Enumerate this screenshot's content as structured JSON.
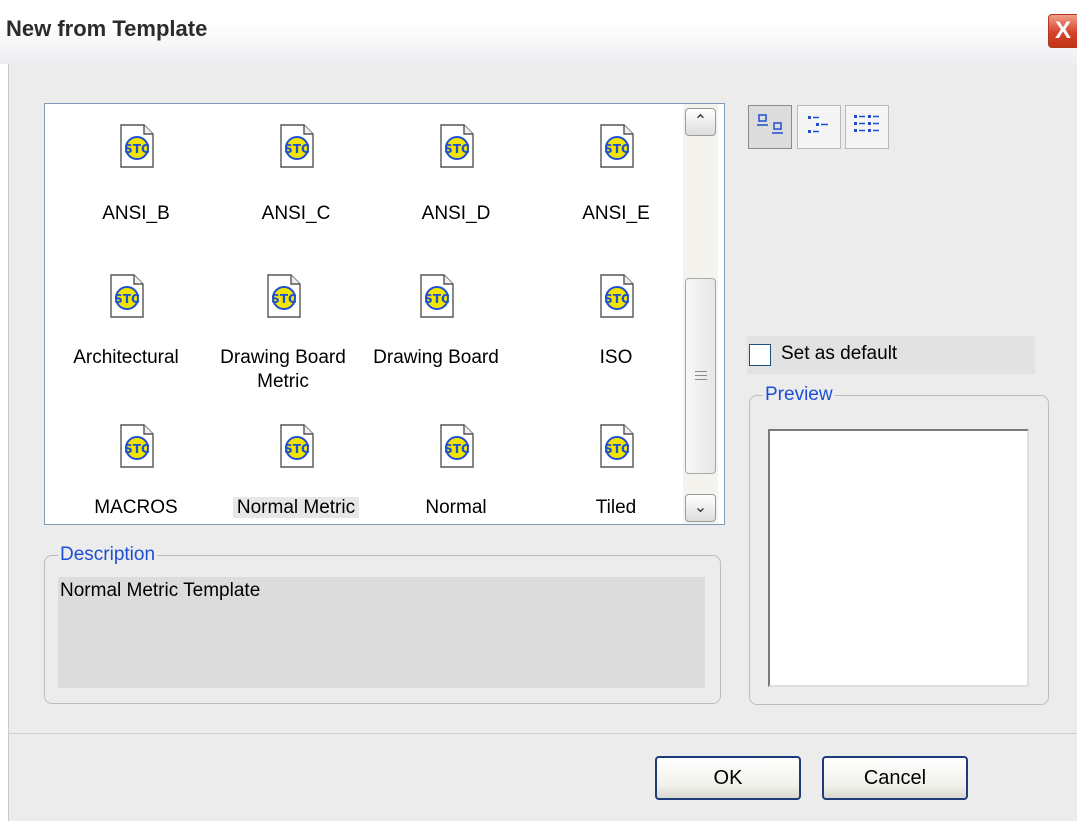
{
  "window": {
    "title": "New from Template",
    "close_glyph": "X"
  },
  "templates": [
    {
      "label": "ANSI_B",
      "icon": "stc-template-icon"
    },
    {
      "label": "ANSI_C",
      "icon": "stc-template-icon"
    },
    {
      "label": "ANSI_D",
      "icon": "stc-template-icon"
    },
    {
      "label": "ANSI_E",
      "icon": "stc-template-icon"
    },
    {
      "label": "Architectural",
      "icon": "stc-template-icon"
    },
    {
      "label_line1": "Drawing Board",
      "label_line2": "Metric",
      "icon": "stc-template-icon"
    },
    {
      "label": "Drawing Board",
      "icon": "stc-template-icon"
    },
    {
      "label": "ISO",
      "icon": "stc-template-icon"
    },
    {
      "label": "MACROS",
      "icon": "stc-template-icon"
    },
    {
      "label": "Normal Metric",
      "icon": "stc-template-icon",
      "selected": true
    },
    {
      "label": "Normal",
      "icon": "stc-template-icon"
    },
    {
      "label": "Tiled",
      "icon": "stc-template-icon"
    }
  ],
  "scrollbar": {
    "up_glyph": "⌃",
    "down_glyph": "⌄",
    "grip_glyph": "≡"
  },
  "view_modes": [
    {
      "name": "large-icons-view-icon",
      "active": true
    },
    {
      "name": "list-view-icon",
      "active": false
    },
    {
      "name": "details-view-icon",
      "active": false
    }
  ],
  "description": {
    "legend": "Description",
    "text": "Normal Metric Template"
  },
  "set_as_default": {
    "label": "Set as default",
    "checked": false
  },
  "preview": {
    "legend": "Preview"
  },
  "buttons": {
    "ok": "OK",
    "cancel": "Cancel"
  },
  "colors": {
    "accent_blue": "#1c4fd6",
    "icon_yellow": "#f2e600",
    "icon_blue": "#1e4fd0"
  }
}
